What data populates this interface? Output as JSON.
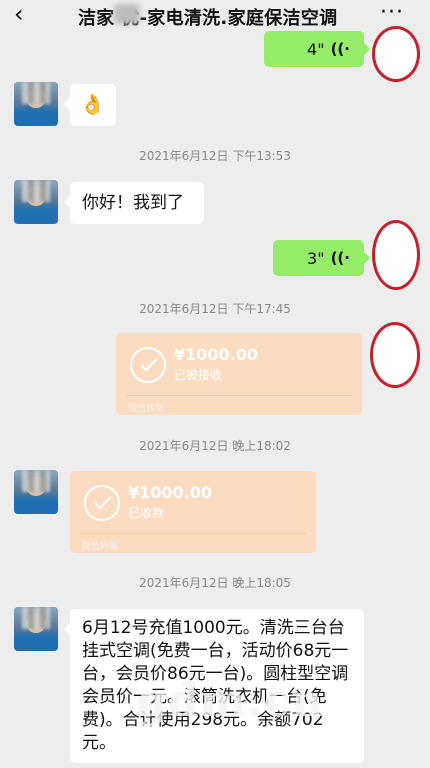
{
  "header": {
    "back_icon": "chevron-left-icon",
    "title": "洁家  优-家电清洗.家庭保洁空调",
    "more_icon": "more-dots-icon"
  },
  "messages": {
    "voice1": {
      "duration": "4\"",
      "icon": "voice-wave-icon"
    },
    "emoji1": {
      "text": "👌"
    },
    "ts1": "2021年6月12日 下午13:53",
    "text1": "你好！我到了",
    "voice2": {
      "duration": "3\"",
      "icon": "voice-wave-icon"
    },
    "ts2": "2021年6月12日 下午17:45",
    "transfer1": {
      "amount": "¥1000.00",
      "status": "已被接收",
      "brand": "微信转账"
    },
    "ts3": "2021年6月12日 晚上18:02",
    "transfer2": {
      "amount": "¥1000.00",
      "status": "已收款",
      "brand": "微信转账"
    },
    "ts4": "2021年6月12日 晚上18:05",
    "text2": "6月12号充值1000元。清洗三台台挂式空调(免费一台，活动价68元一台，会员价86元一台)。圆柱型空调会员价一元。滚筒洗衣机一台(免费)。合计使用298元。余额702元。"
  },
  "watermark": "gdm.cn",
  "colors": {
    "background": "#ededed",
    "voice_bubble": "#95ec69",
    "transfer_card": "#fbdcc1",
    "annotation_circle": "#c8202a"
  }
}
